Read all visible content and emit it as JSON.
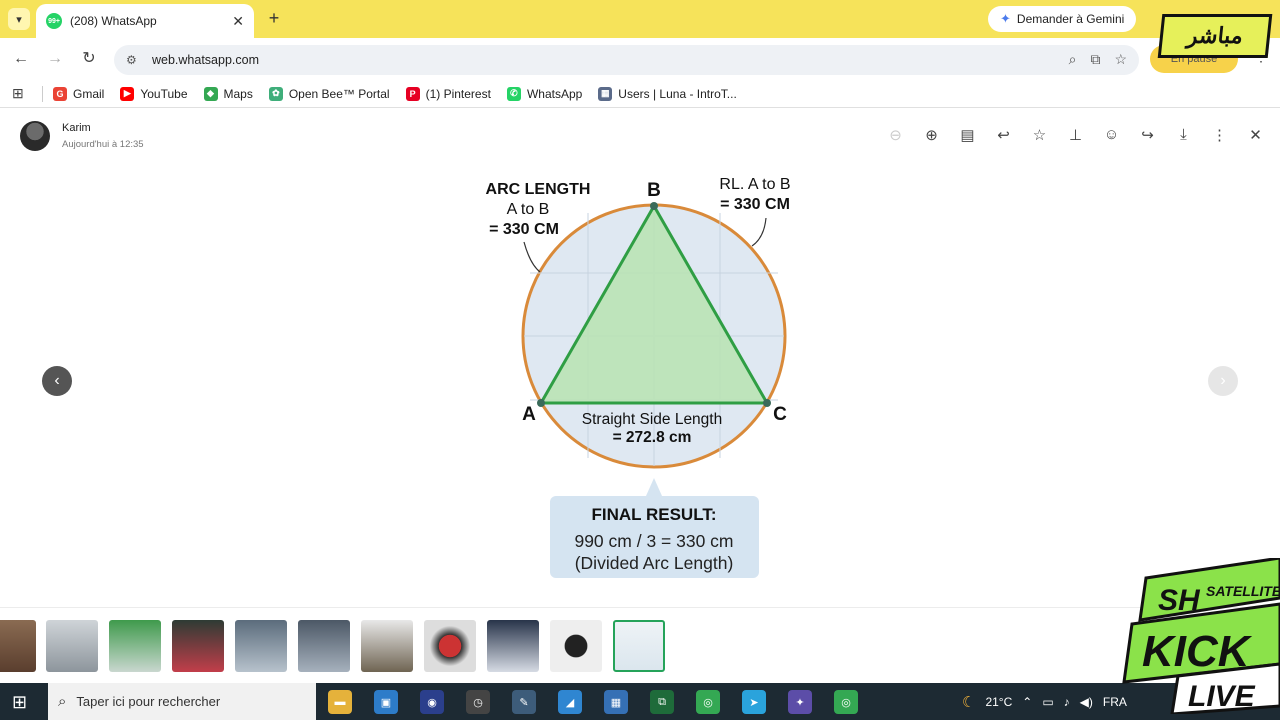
{
  "browser": {
    "tab_title": "(208) WhatsApp",
    "tab_badge": "99+",
    "gemini_label": "Demander à Gemini",
    "url": "web.whatsapp.com",
    "paused_label": "En pause"
  },
  "bookmarks": [
    {
      "label": "Gmail",
      "icon": "gmail-icon",
      "color": "#ea4335",
      "glyph": "G"
    },
    {
      "label": "YouTube",
      "icon": "youtube-icon",
      "color": "#ff0000",
      "glyph": "▶"
    },
    {
      "label": "Maps",
      "icon": "maps-icon",
      "color": "#34a853",
      "glyph": "◆"
    },
    {
      "label": "Open Bee™ Portal",
      "icon": "openbee-icon",
      "color": "#3fae7a",
      "glyph": "✿"
    },
    {
      "label": "(1) Pinterest",
      "icon": "pinterest-icon",
      "color": "#e60023",
      "glyph": "P"
    },
    {
      "label": "WhatsApp",
      "icon": "whatsapp-icon",
      "color": "#25d366",
      "glyph": "✆"
    },
    {
      "label": "Users | Luna - IntroT...",
      "icon": "table-icon",
      "color": "#5b6b8a",
      "glyph": "▦"
    }
  ],
  "viewer": {
    "sender": "Karim",
    "time": "Aujourd'hui à 12:35"
  },
  "figure": {
    "arc_title": "ARC LENGTH",
    "arc_sub": "A to B",
    "arc_value": "= 330 CM",
    "rl_title": "RL. A to B",
    "rl_value": "= 330 CM",
    "label_a": "A",
    "label_b": "B",
    "label_c": "C",
    "side_title": "Straight Side Length",
    "side_value": "= 272.8 cm",
    "result_title": "FINAL RESULT:",
    "result_line1": "990 cm / 3 = 330 cm",
    "result_line2": "(Divided Arc Length)"
  },
  "taskbar": {
    "search_placeholder": "Taper ici pour rechercher",
    "temperature": "21°C",
    "language": "FRA"
  },
  "overlays": {
    "top_text": "مباشر",
    "brand_line1": "SH",
    "brand_line2": "SATELLITE",
    "brand_line3": "KICK",
    "brand_line4": "LIVE"
  },
  "colors": {
    "accent_green": "#25a35a",
    "circle_stroke": "#d98a3a",
    "triangle_stroke": "#2f9e44"
  }
}
